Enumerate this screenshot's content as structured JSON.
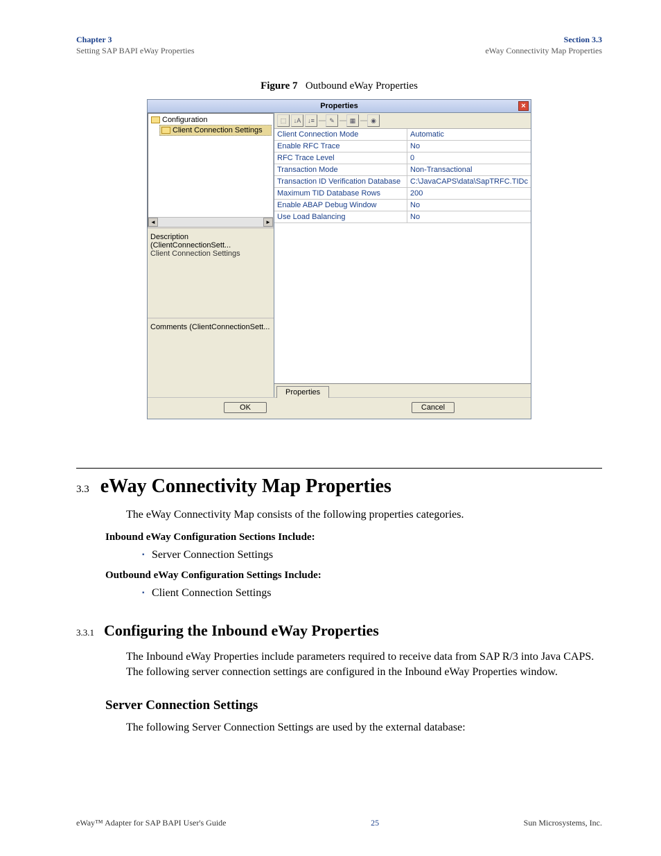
{
  "header": {
    "chapterLeft": "Chapter 3",
    "subtitleLeft": "Setting SAP BAPI eWay Properties",
    "sectionRight": "Section 3.3",
    "subtitleRight": "eWay Connectivity Map Properties"
  },
  "figure": {
    "label": "Figure 7",
    "title": "Outbound eWay Properties"
  },
  "dialog": {
    "title": "Properties",
    "tree": {
      "root": "Configuration",
      "selected": "Client Connection Settings"
    },
    "descLabel": "Description (ClientConnectionSett...",
    "descValue": "Client Connection Settings",
    "commentsLabel": "Comments (ClientConnectionSett...",
    "tabLabel": "Properties",
    "ok": "OK",
    "cancel": "Cancel",
    "props": [
      {
        "name": "Client Connection Mode",
        "value": "Automatic"
      },
      {
        "name": "Enable RFC Trace",
        "value": "No"
      },
      {
        "name": "RFC Trace Level",
        "value": "0"
      },
      {
        "name": "Transaction Mode",
        "value": "Non-Transactional"
      },
      {
        "name": "Transaction ID Verification Database",
        "value": "C:\\JavaCAPS\\data\\SapTRFC.TIDc"
      },
      {
        "name": "Maximum TID Database Rows",
        "value": "200"
      },
      {
        "name": "Enable ABAP Debug Window",
        "value": "No"
      },
      {
        "name": "Use Load Balancing",
        "value": "No"
      }
    ]
  },
  "section": {
    "num": "3.3",
    "title": "eWay Connectivity Map Properties",
    "intro": "The eWay Connectivity Map consists of the following properties categories.",
    "inboundHeading": "Inbound eWay Configuration Sections Include:",
    "inboundItems": [
      "Server Connection Settings"
    ],
    "outboundHeading": "Outbound eWay Configuration Settings Include:",
    "outboundItems": [
      "Client Connection Settings"
    ]
  },
  "subsection": {
    "num": "3.3.1",
    "title": "Configuring the Inbound eWay Properties",
    "body": "The Inbound eWay Properties include parameters required to receive data from SAP R/3 into Java CAPS. The following server connection settings are configured in the Inbound eWay Properties window.",
    "subhead": "Server Connection Settings",
    "subbody": "The following Server Connection Settings are used by the external database:"
  },
  "footer": {
    "left": "eWay™ Adapter for SAP BAPI User's Guide",
    "page": "25",
    "right": "Sun Microsystems, Inc."
  }
}
